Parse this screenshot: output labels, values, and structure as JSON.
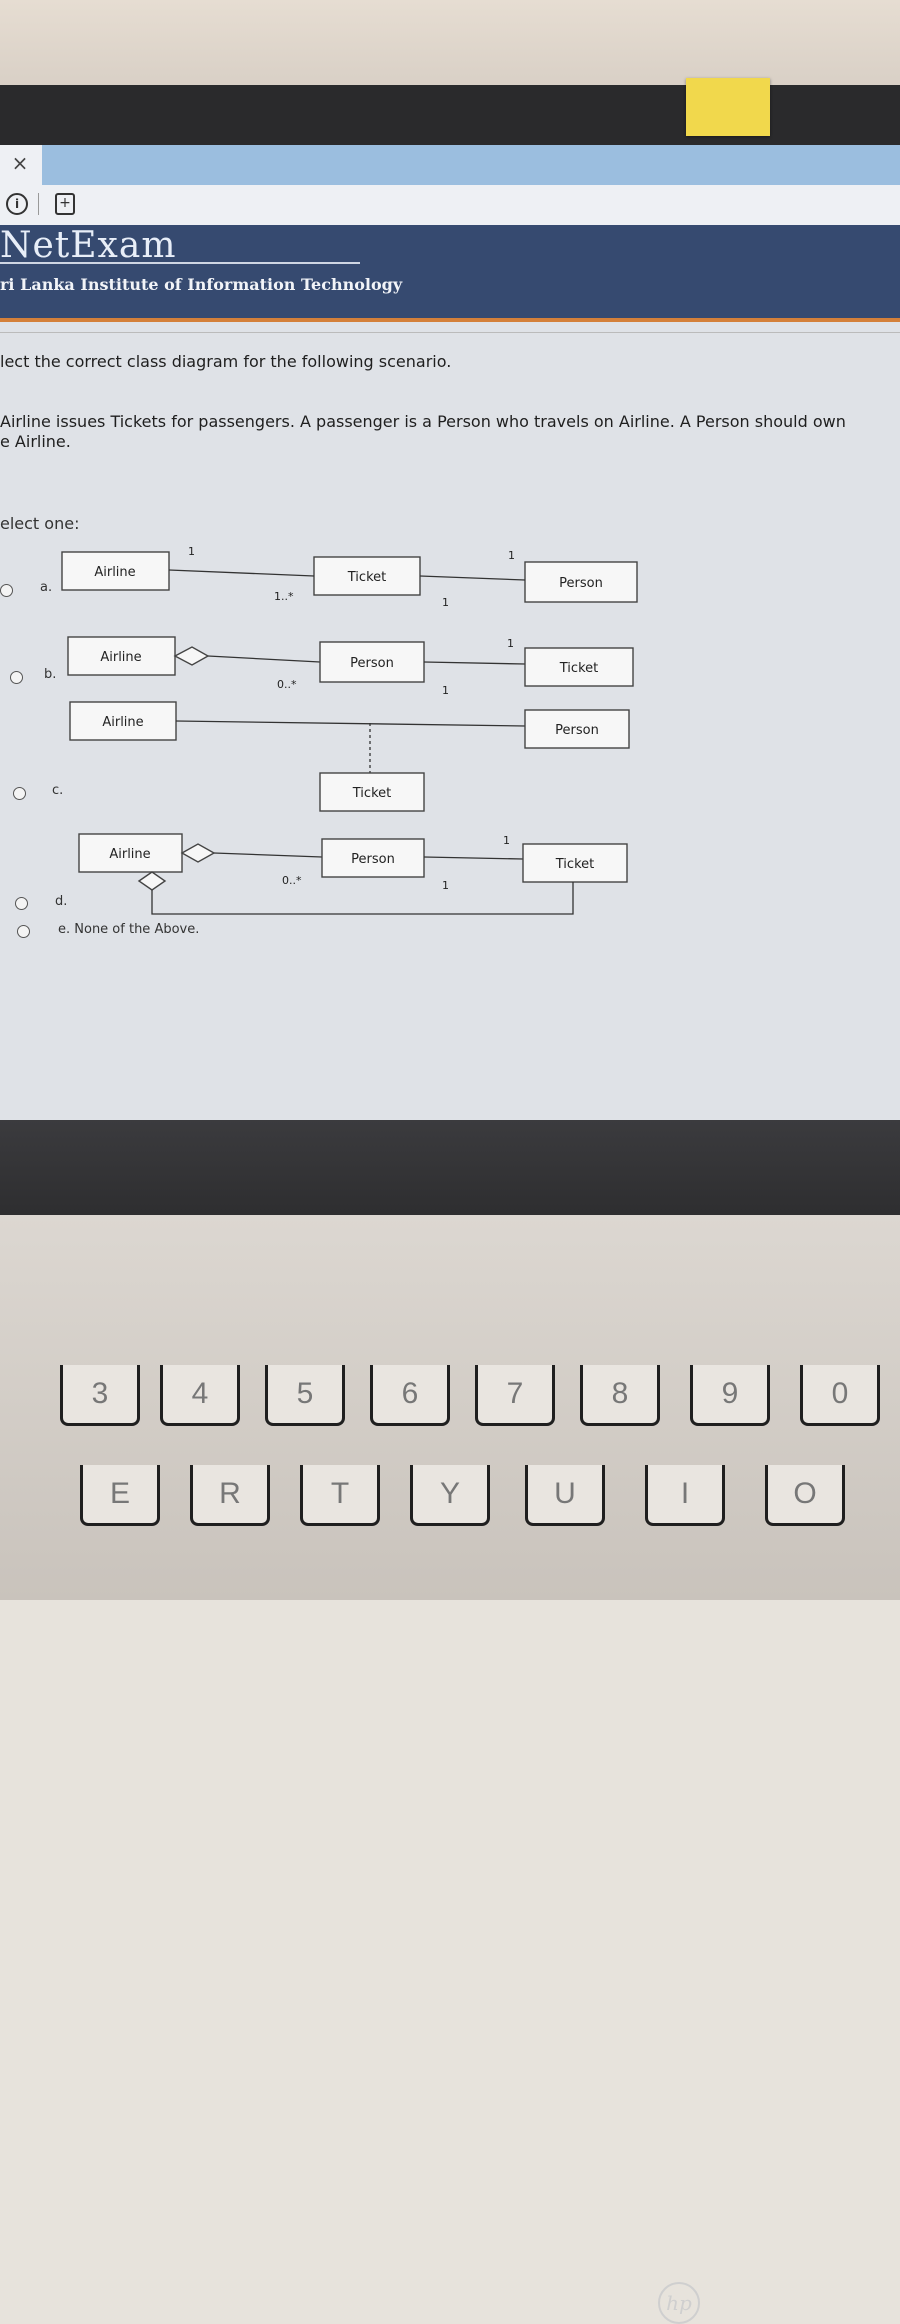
{
  "browser": {
    "close_glyph": "×",
    "info_glyph": "i",
    "new_tab_glyph": "+"
  },
  "site": {
    "logo": "NetExam",
    "institute": "ri Lanka Institute of Information Technology"
  },
  "question": {
    "prompt": "lect the correct class diagram for the following scenario.",
    "scenario_line1": "Airline issues Tickets for passengers.  A passenger is a Person who travels on Airline.  A Person should own",
    "scenario_line2": "e Airline.",
    "select_label": "elect one:"
  },
  "options": [
    {
      "letter": "a.",
      "classes": [
        "Airline",
        "Ticket",
        "Person"
      ],
      "multiplicities": [
        "1",
        "1..*",
        "1",
        "1"
      ]
    },
    {
      "letter": "b.",
      "classes": [
        "Airline",
        "Person",
        "Ticket"
      ],
      "multiplicities": [
        "0..*",
        "1",
        "1"
      ]
    },
    {
      "letter": "c.",
      "classes": [
        "Airline",
        "Person",
        "Ticket"
      ]
    },
    {
      "letter": "d.",
      "classes": [
        "Airline",
        "Person",
        "Ticket"
      ],
      "multiplicities": [
        "0..*",
        "1",
        "1"
      ]
    },
    {
      "letter": "e. None of the Above."
    }
  ],
  "laptop": {
    "brand": "hp",
    "keys_row1": [
      "3",
      "4",
      "5",
      "6",
      "7",
      "8",
      "9",
      "0"
    ],
    "keys_row2": [
      "E",
      "R",
      "T",
      "Y",
      "U",
      "I",
      "O"
    ]
  },
  "colors": {
    "header_bg": "#364a70",
    "header_accent": "#d4803a",
    "tab_active": "#9bbedf"
  }
}
